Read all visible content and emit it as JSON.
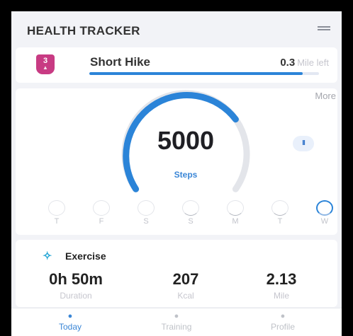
{
  "header": {
    "title": "HEALTH TRACKER",
    "menu_icon": "hamburger-menu-icon"
  },
  "hike": {
    "level": "3",
    "badge_icon": "hiker-icon",
    "title": "Short Hike",
    "distance_value": "0.3",
    "distance_suffix": "Mile left",
    "progress_percent": 93
  },
  "steps": {
    "more_label": "More",
    "value": "5000",
    "label": "Steps",
    "ring_progress": 0.72,
    "pause_symbol": "II",
    "days": [
      {
        "label": "T",
        "state": "empty"
      },
      {
        "label": "F",
        "state": "empty"
      },
      {
        "label": "S",
        "state": "empty"
      },
      {
        "label": "S",
        "state": "partial"
      },
      {
        "label": "M",
        "state": "partial"
      },
      {
        "label": "T",
        "state": "partial"
      },
      {
        "label": "W",
        "state": "full"
      }
    ]
  },
  "exercise": {
    "icon": "runner-icon",
    "title": "Exercise",
    "stats": [
      {
        "value": "0h 50m",
        "label": "Duration"
      },
      {
        "value": "207",
        "label": "Kcal"
      },
      {
        "value": "2.13",
        "label": "Mile"
      }
    ]
  },
  "nav": {
    "items": [
      {
        "label": "Today",
        "icon": "home-icon",
        "active": true
      },
      {
        "label": "Training",
        "icon": "training-icon",
        "active": false
      },
      {
        "label": "Profile",
        "icon": "profile-icon",
        "active": false
      }
    ]
  },
  "colors": {
    "accent": "#2b84d8",
    "badge": "#c83b83",
    "ring_track": "#e3e5ea"
  }
}
